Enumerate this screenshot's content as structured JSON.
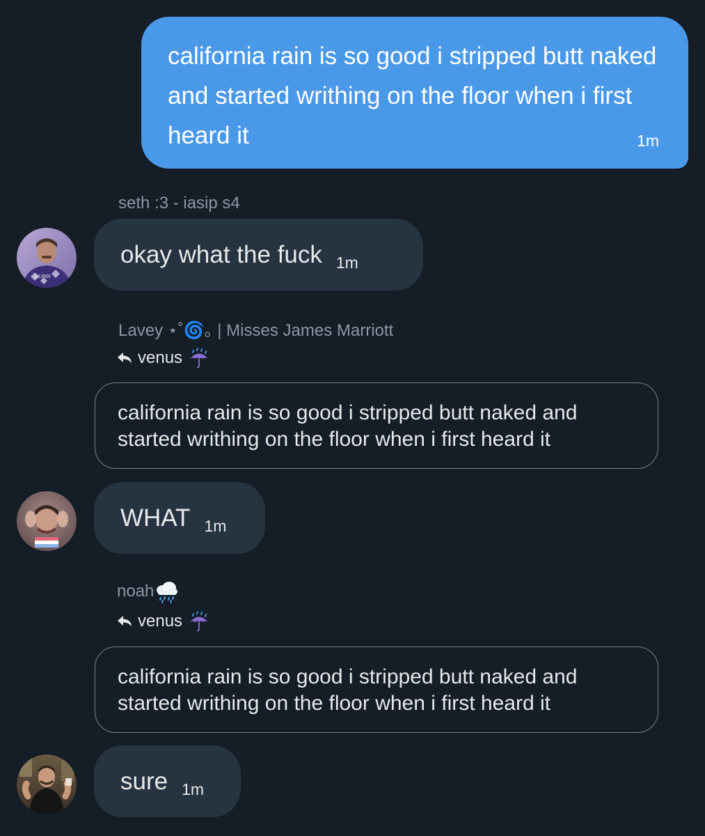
{
  "outgoing_message": {
    "text": "california rain is so good i stripped butt naked and started writhing on the floor when i first heard it",
    "time": "1m"
  },
  "messages": [
    {
      "sender": "seth :3 - iasip s4",
      "text": "okay what the fuck",
      "time": "1m"
    },
    {
      "sender": "Lavey ⋆˚🌀｡ | Misses James Marriott",
      "reply_to": "venus",
      "reply_emoji": "umbrella-rain-icon",
      "quoted_text": "california rain is so good i stripped butt naked and started writhing on the floor when i first heard it",
      "text": "WHAT",
      "time": "1m"
    },
    {
      "sender": "noah",
      "sender_emoji": "rain-cloud-icon",
      "reply_to": "venus",
      "reply_emoji": "umbrella-rain-icon",
      "quoted_text": "california rain is so good i stripped butt naked and started writhing on the floor when i first heard it",
      "text": "sure",
      "time": "1m"
    }
  ],
  "colors": {
    "background": "#151d27",
    "outgoing_bubble": "#4a99e9",
    "incoming_bubble": "#263340",
    "muted_text": "#8b98a5"
  }
}
